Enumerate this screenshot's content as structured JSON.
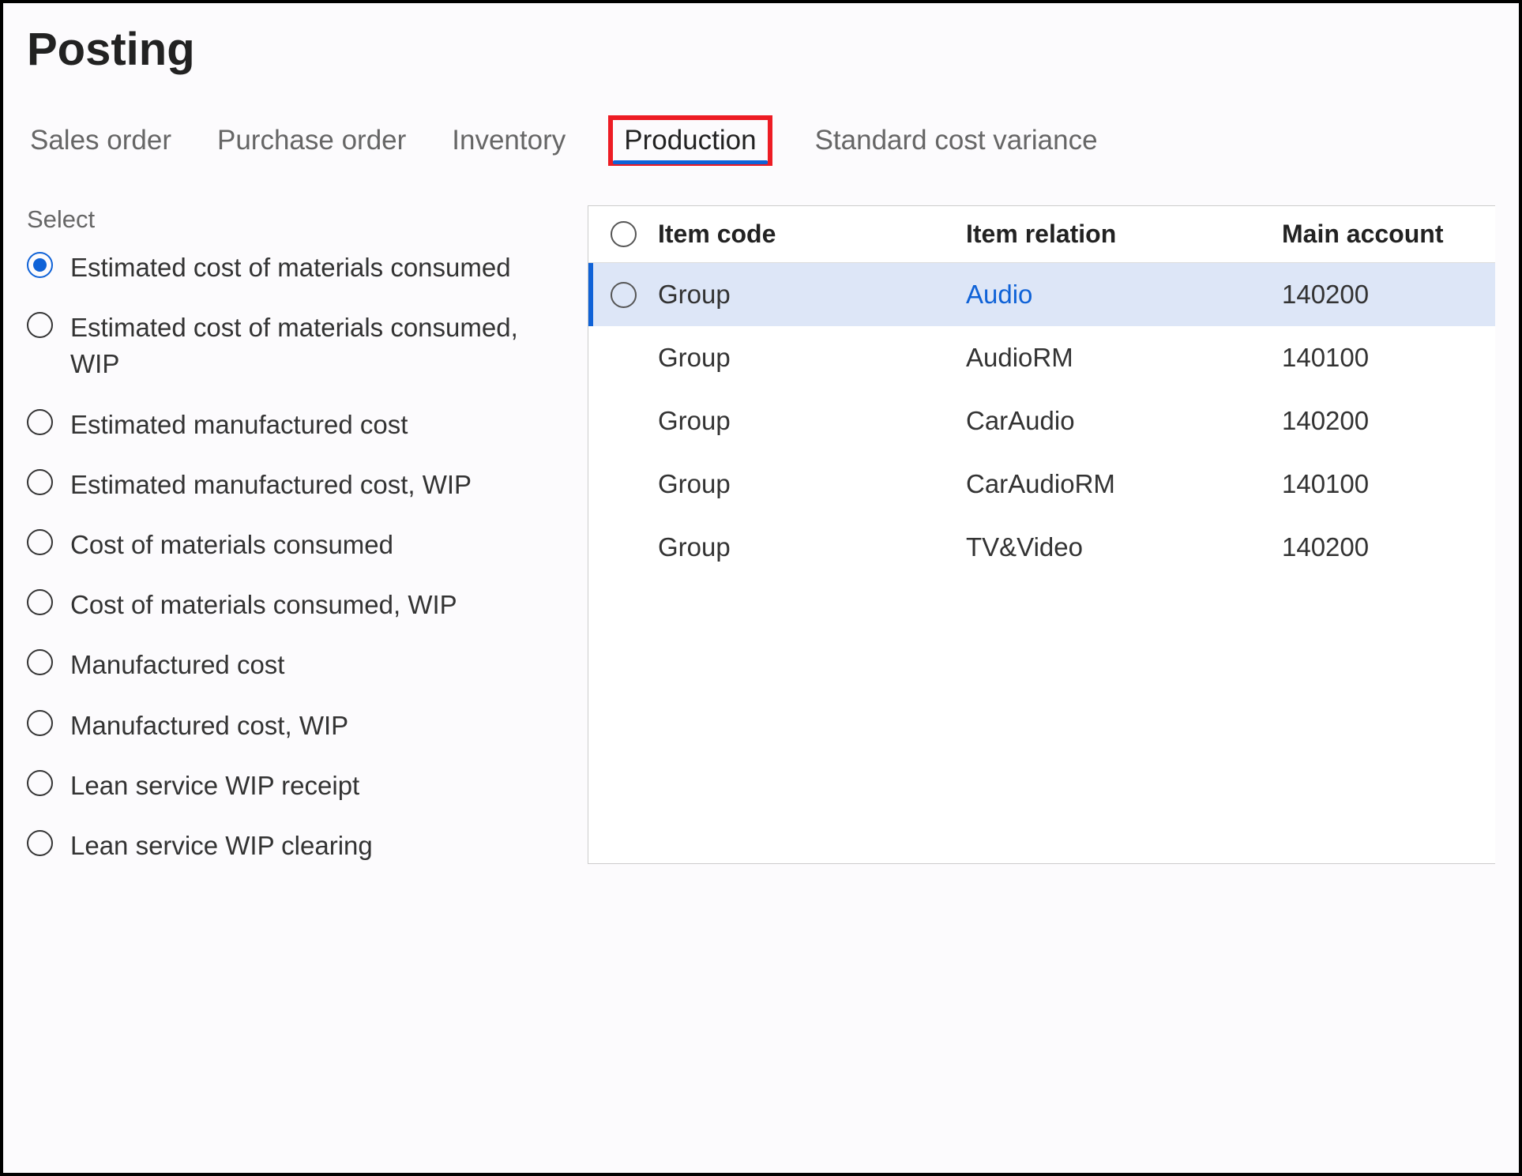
{
  "page": {
    "title": "Posting"
  },
  "tabs": [
    {
      "label": "Sales order",
      "active": false,
      "highlighted": false
    },
    {
      "label": "Purchase order",
      "active": false,
      "highlighted": false
    },
    {
      "label": "Inventory",
      "active": false,
      "highlighted": false
    },
    {
      "label": "Production",
      "active": true,
      "highlighted": true
    },
    {
      "label": "Standard cost variance",
      "active": false,
      "highlighted": false
    }
  ],
  "select": {
    "label": "Select",
    "options": [
      {
        "label": "Estimated cost of materials consumed",
        "selected": true
      },
      {
        "label": "Estimated cost of materials consumed, WIP",
        "selected": false
      },
      {
        "label": "Estimated manufactured cost",
        "selected": false
      },
      {
        "label": "Estimated manufactured cost, WIP",
        "selected": false
      },
      {
        "label": "Cost of materials consumed",
        "selected": false
      },
      {
        "label": "Cost of materials consumed, WIP",
        "selected": false
      },
      {
        "label": "Manufactured cost",
        "selected": false
      },
      {
        "label": "Manufactured cost, WIP",
        "selected": false
      },
      {
        "label": "Lean service WIP receipt",
        "selected": false
      },
      {
        "label": "Lean service WIP clearing",
        "selected": false
      }
    ]
  },
  "grid": {
    "headers": {
      "item_code": "Item code",
      "item_relation": "Item relation",
      "main_account": "Main account"
    },
    "rows": [
      {
        "item_code": "Group",
        "item_relation": "Audio",
        "main_account": "140200",
        "selected": true
      },
      {
        "item_code": "Group",
        "item_relation": "AudioRM",
        "main_account": "140100",
        "selected": false
      },
      {
        "item_code": "Group",
        "item_relation": "CarAudio",
        "main_account": "140200",
        "selected": false
      },
      {
        "item_code": "Group",
        "item_relation": "CarAudioRM",
        "main_account": "140100",
        "selected": false
      },
      {
        "item_code": "Group",
        "item_relation": "TV&Video",
        "main_account": "140200",
        "selected": false
      }
    ]
  }
}
